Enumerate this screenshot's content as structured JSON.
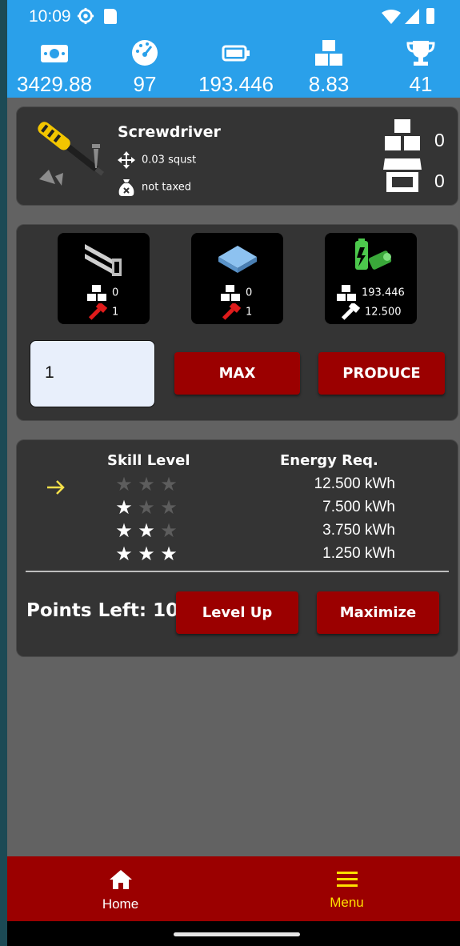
{
  "status_bar": {
    "time": "10:09",
    "icons": [
      "gear-icon",
      "sd-card-icon",
      "wifi-icon",
      "signal-icon",
      "battery-icon"
    ]
  },
  "header_stats": [
    {
      "icon": "money-icon",
      "value": "3429.88"
    },
    {
      "icon": "speedometer-icon",
      "value": "97"
    },
    {
      "icon": "battery-icon",
      "value": "193.446"
    },
    {
      "icon": "cubes-icon",
      "value": "8.83"
    },
    {
      "icon": "trophy-icon",
      "value": "41"
    }
  ],
  "item": {
    "name": "Screwdriver",
    "size": "0.03 squst",
    "tax": "not taxed",
    "inventory": "0",
    "store": "0"
  },
  "resources": [
    {
      "icon": "steel-beam-icon",
      "stock": "0",
      "required": "1",
      "req_color": "#e01b1b"
    },
    {
      "icon": "plate-icon",
      "stock": "0",
      "required": "1",
      "req_color": "#e01b1b"
    },
    {
      "icon": "energy-battery-icon",
      "stock": "193.446",
      "required": "12.500",
      "req_color": "#ffffff"
    }
  ],
  "production": {
    "quantity_value": "1",
    "max_label": "MAX",
    "produce_label": "PRODUCE"
  },
  "skills": {
    "skill_header": "Skill Level",
    "energy_header": "Energy Req.",
    "levels": [
      {
        "stars": 0,
        "energy": "12.500 kWh"
      },
      {
        "stars": 1,
        "energy": "7.500 kWh"
      },
      {
        "stars": 2,
        "energy": "3.750 kWh"
      },
      {
        "stars": 3,
        "energy": "1.250 kWh"
      }
    ],
    "current_level_index": 0,
    "points_left": "Points Left: 10",
    "level_up_label": "Level Up",
    "maximize_label": "Maximize"
  },
  "nav": {
    "home_label": "Home",
    "menu_label": "Menu"
  },
  "colors": {
    "accent": "#2aa0ea",
    "button": "#9b0000",
    "active_nav": "#ffe000"
  }
}
